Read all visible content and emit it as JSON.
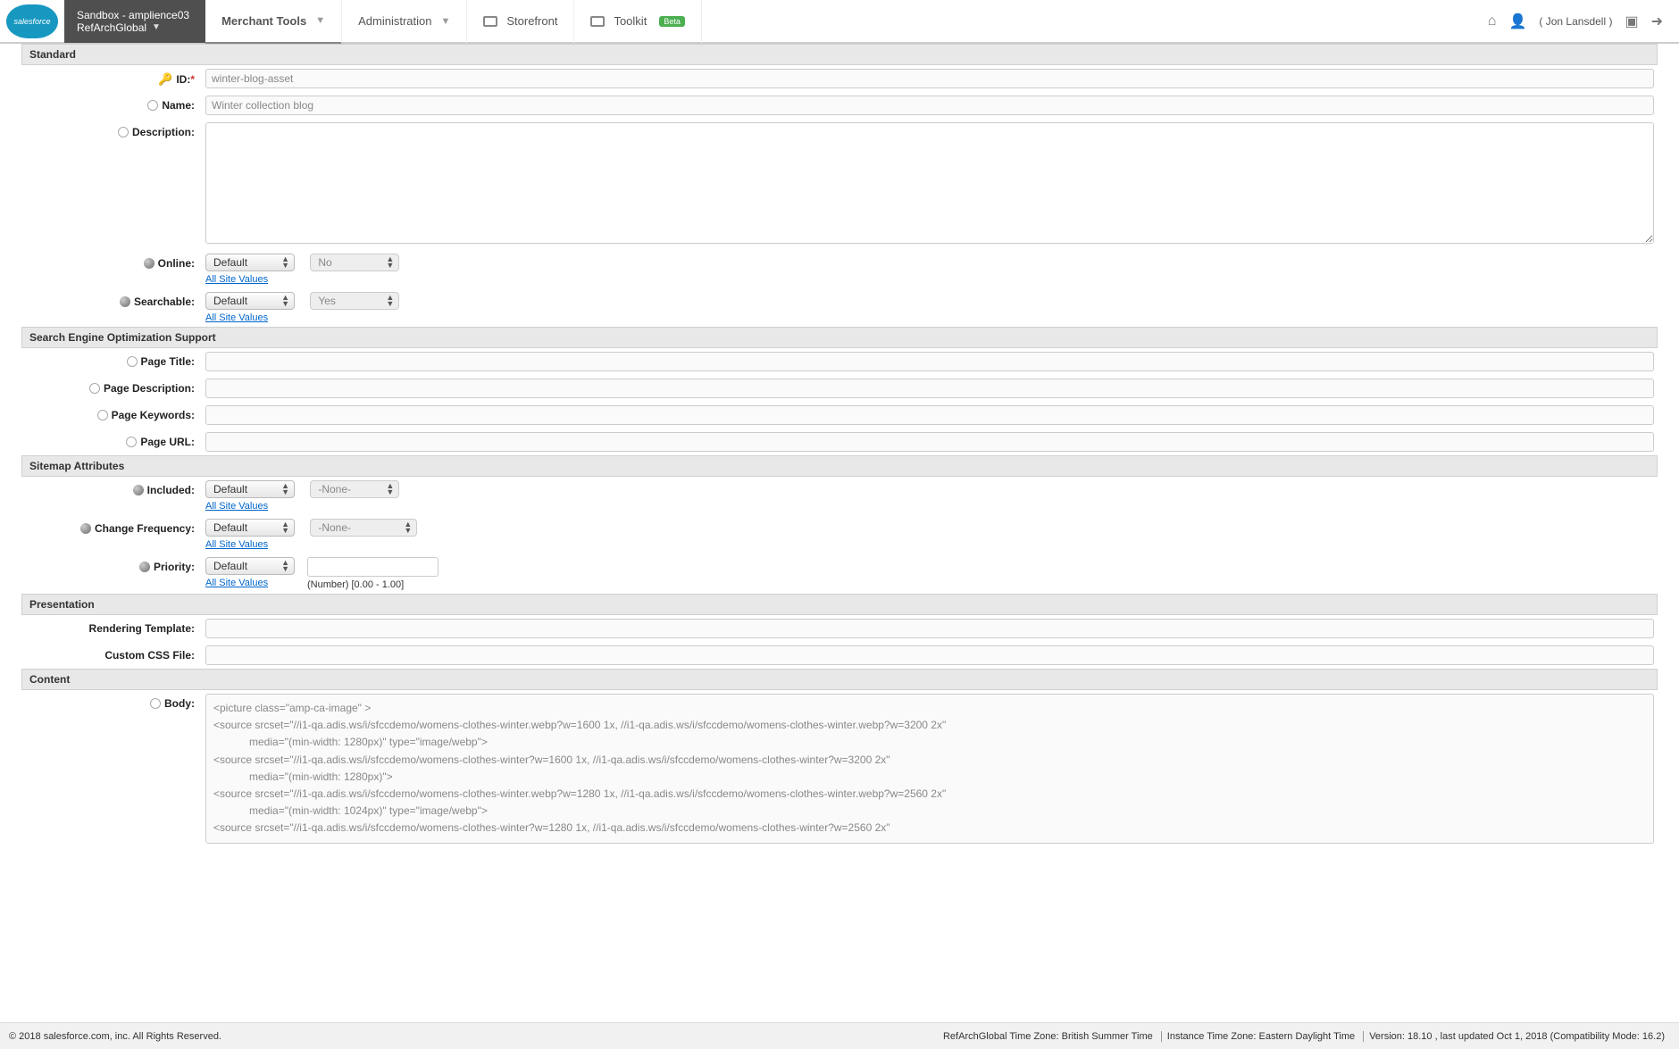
{
  "logo_text": "salesforce",
  "sandbox": {
    "line1": "Sandbox - amplience03",
    "line2": "RefArchGlobal"
  },
  "nav": {
    "merchant_tools": "Merchant Tools",
    "administration": "Administration",
    "storefront": "Storefront",
    "toolkit": "Toolkit",
    "toolkit_badge": "Beta"
  },
  "user": {
    "name": "Jon Lansdell"
  },
  "sections": {
    "standard": "Standard",
    "seo": "Search Engine Optimization Support",
    "sitemap": "Sitemap Attributes",
    "presentation": "Presentation",
    "content": "Content"
  },
  "fields": {
    "id": {
      "label": "ID:",
      "value": "winter-blog-asset"
    },
    "name": {
      "label": "Name:",
      "value": "Winter collection blog"
    },
    "description": {
      "label": "Description:",
      "value": ""
    },
    "online": {
      "label": "Online:",
      "select": "Default",
      "second": "No",
      "link": "All Site Values"
    },
    "searchable": {
      "label": "Searchable:",
      "select": "Default",
      "second": "Yes",
      "link": "All Site Values"
    },
    "page_title": {
      "label": "Page Title:",
      "value": ""
    },
    "page_description": {
      "label": "Page Description:",
      "value": ""
    },
    "page_keywords": {
      "label": "Page Keywords:",
      "value": ""
    },
    "page_url": {
      "label": "Page URL:",
      "value": ""
    },
    "included": {
      "label": "Included:",
      "select": "Default",
      "second": "-None-",
      "link": "All Site Values"
    },
    "change_frequency": {
      "label": "Change Frequency:",
      "select": "Default",
      "second": "-None-",
      "link": "All Site Values"
    },
    "priority": {
      "label": "Priority:",
      "select": "Default",
      "value": "",
      "hint": "(Number) [0.00 - 1.00]",
      "link": "All Site Values"
    },
    "rendering_template": {
      "label": "Rendering Template:",
      "value": ""
    },
    "custom_css": {
      "label": "Custom CSS File:",
      "value": ""
    },
    "body": {
      "label": "Body:",
      "value": "<picture class=\"amp-ca-image\" >\n<source srcset=\"//i1-qa.adis.ws/i/sfccdemo/womens-clothes-winter.webp?w=1600 1x, //i1-qa.adis.ws/i/sfccdemo/womens-clothes-winter.webp?w=3200 2x\"\n            media=\"(min-width: 1280px)\" type=\"image/webp\">\n<source srcset=\"//i1-qa.adis.ws/i/sfccdemo/womens-clothes-winter?w=1600 1x, //i1-qa.adis.ws/i/sfccdemo/womens-clothes-winter?w=3200 2x\"\n            media=\"(min-width: 1280px)\">\n<source srcset=\"//i1-qa.adis.ws/i/sfccdemo/womens-clothes-winter.webp?w=1280 1x, //i1-qa.adis.ws/i/sfccdemo/womens-clothes-winter.webp?w=2560 2x\"\n            media=\"(min-width: 1024px)\" type=\"image/webp\">\n<source srcset=\"//i1-qa.adis.ws/i/sfccdemo/womens-clothes-winter?w=1280 1x, //i1-qa.adis.ws/i/sfccdemo/womens-clothes-winter?w=2560 2x\""
    }
  },
  "footer": {
    "copyright": "© 2018 salesforce.com, inc. All Rights Reserved.",
    "tz1": "RefArchGlobal Time Zone: British Summer Time",
    "tz2": "Instance Time Zone: Eastern Daylight Time",
    "version": "Version: 18.10 , last updated Oct 1, 2018 (Compatibility Mode: 16.2)"
  }
}
